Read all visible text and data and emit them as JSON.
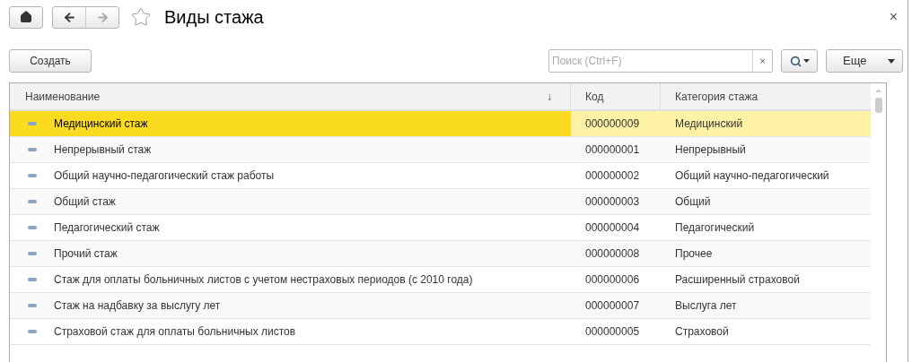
{
  "window": {
    "title": "Виды стажа",
    "favorite": false,
    "close": "×"
  },
  "toolbar": {
    "create_button": "Создать",
    "search": {
      "placeholder": "Поиск (Ctrl+F)",
      "clear": "×"
    },
    "more_button": "Еще"
  },
  "table": {
    "columns": [
      {
        "label": "Наименование",
        "sort": "↓"
      },
      {
        "label": "Код"
      },
      {
        "label": "Категория стажа"
      }
    ],
    "rows": [
      {
        "name": "Медицинский стаж",
        "code": "000000009",
        "category": "Медицинский",
        "selected": true
      },
      {
        "name": "Непрерывный стаж",
        "code": "000000001",
        "category": "Непрерывный",
        "selected": false
      },
      {
        "name": "Общий научно-педагогический стаж работы",
        "code": "000000002",
        "category": "Общий научно-педагогический",
        "selected": false
      },
      {
        "name": "Общий стаж",
        "code": "000000003",
        "category": "Общий",
        "selected": false
      },
      {
        "name": "Педагогический стаж",
        "code": "000000004",
        "category": "Педагогический",
        "selected": false
      },
      {
        "name": "Прочий стаж",
        "code": "000000008",
        "category": "Прочее",
        "selected": false
      },
      {
        "name": "Стаж для оплаты больничных листов с учетом нестраховых периодов (с 2010 года)",
        "code": "000000006",
        "category": "Расширенный страховой",
        "selected": false
      },
      {
        "name": "Стаж на надбавку за выслугу лет",
        "code": "000000007",
        "category": "Выслуга лет",
        "selected": false
      },
      {
        "name": "Страховой стаж для оплаты больничных листов",
        "code": "000000005",
        "category": "Страховой",
        "selected": false
      }
    ]
  }
}
